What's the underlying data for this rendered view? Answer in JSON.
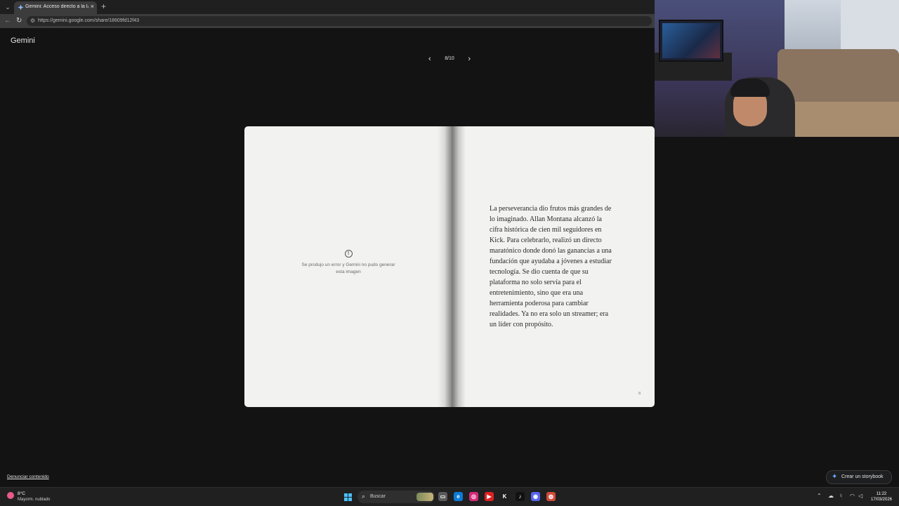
{
  "browser": {
    "tab_title": "Gemini: Acceso directo a la IA de Google",
    "tab_close": "×",
    "new_tab": "+",
    "url": "https://gemini.google.com/share/18609fd12f43",
    "nav": {
      "back": "←",
      "reload": "↻"
    },
    "tab_menu": "⌄"
  },
  "page": {
    "logo": "Gemini",
    "pager": {
      "prev": "‹",
      "count": "8/10",
      "next": "›"
    },
    "book": {
      "error_icon": "!",
      "error_text": "Se produjo un error y Gemini no pudo generar esta imagen",
      "story_text": "La perseverancia dio frutos más grandes de lo imaginado. Allan Montana alcanzó la cifra histórica de cien mil seguidores en Kick. Para celebrarlo, realizó un directo maratónico donde donó las ganancias a una fundación que ayudaba a jóvenes a estudiar tecnología. Se dio cuenta de que su plataforma no solo servía para el entretenimiento, sino que era una herramienta poderosa para cambiar realidades. Ya no era solo un streamer; era un líder con propósito.",
      "page_number": "8"
    },
    "report_link": "Denunciar contenido",
    "storybook_button": "Crear un storybook"
  },
  "taskbar": {
    "weather_temp": "8°C",
    "weather_condition": "Mayorm. nublado",
    "search_label": "Buscar",
    "apps": [
      {
        "name": "file-explorer-icon",
        "glyph": "▭",
        "color": "#5a5a5a"
      },
      {
        "name": "edge-icon",
        "glyph": "e",
        "color": "#0a7bd6"
      },
      {
        "name": "instagram-icon",
        "glyph": "◎",
        "color": "#d6297a"
      },
      {
        "name": "youtube-icon",
        "glyph": "▶",
        "color": "#e02020"
      },
      {
        "name": "kick-icon",
        "glyph": "K",
        "color": "#1d1d1d"
      },
      {
        "name": "tiktok-icon",
        "glyph": "♪",
        "color": "#111111"
      },
      {
        "name": "discord-icon",
        "glyph": "◉",
        "color": "#5865f2"
      },
      {
        "name": "chrome-icon",
        "glyph": "◍",
        "color": "#d04a3a"
      }
    ],
    "clock_time": "11:22",
    "clock_date": "17/03/2026"
  },
  "colors": {
    "accent": "#6aa7ff",
    "background": "#131314",
    "book_page": "#f2f2f0"
  }
}
